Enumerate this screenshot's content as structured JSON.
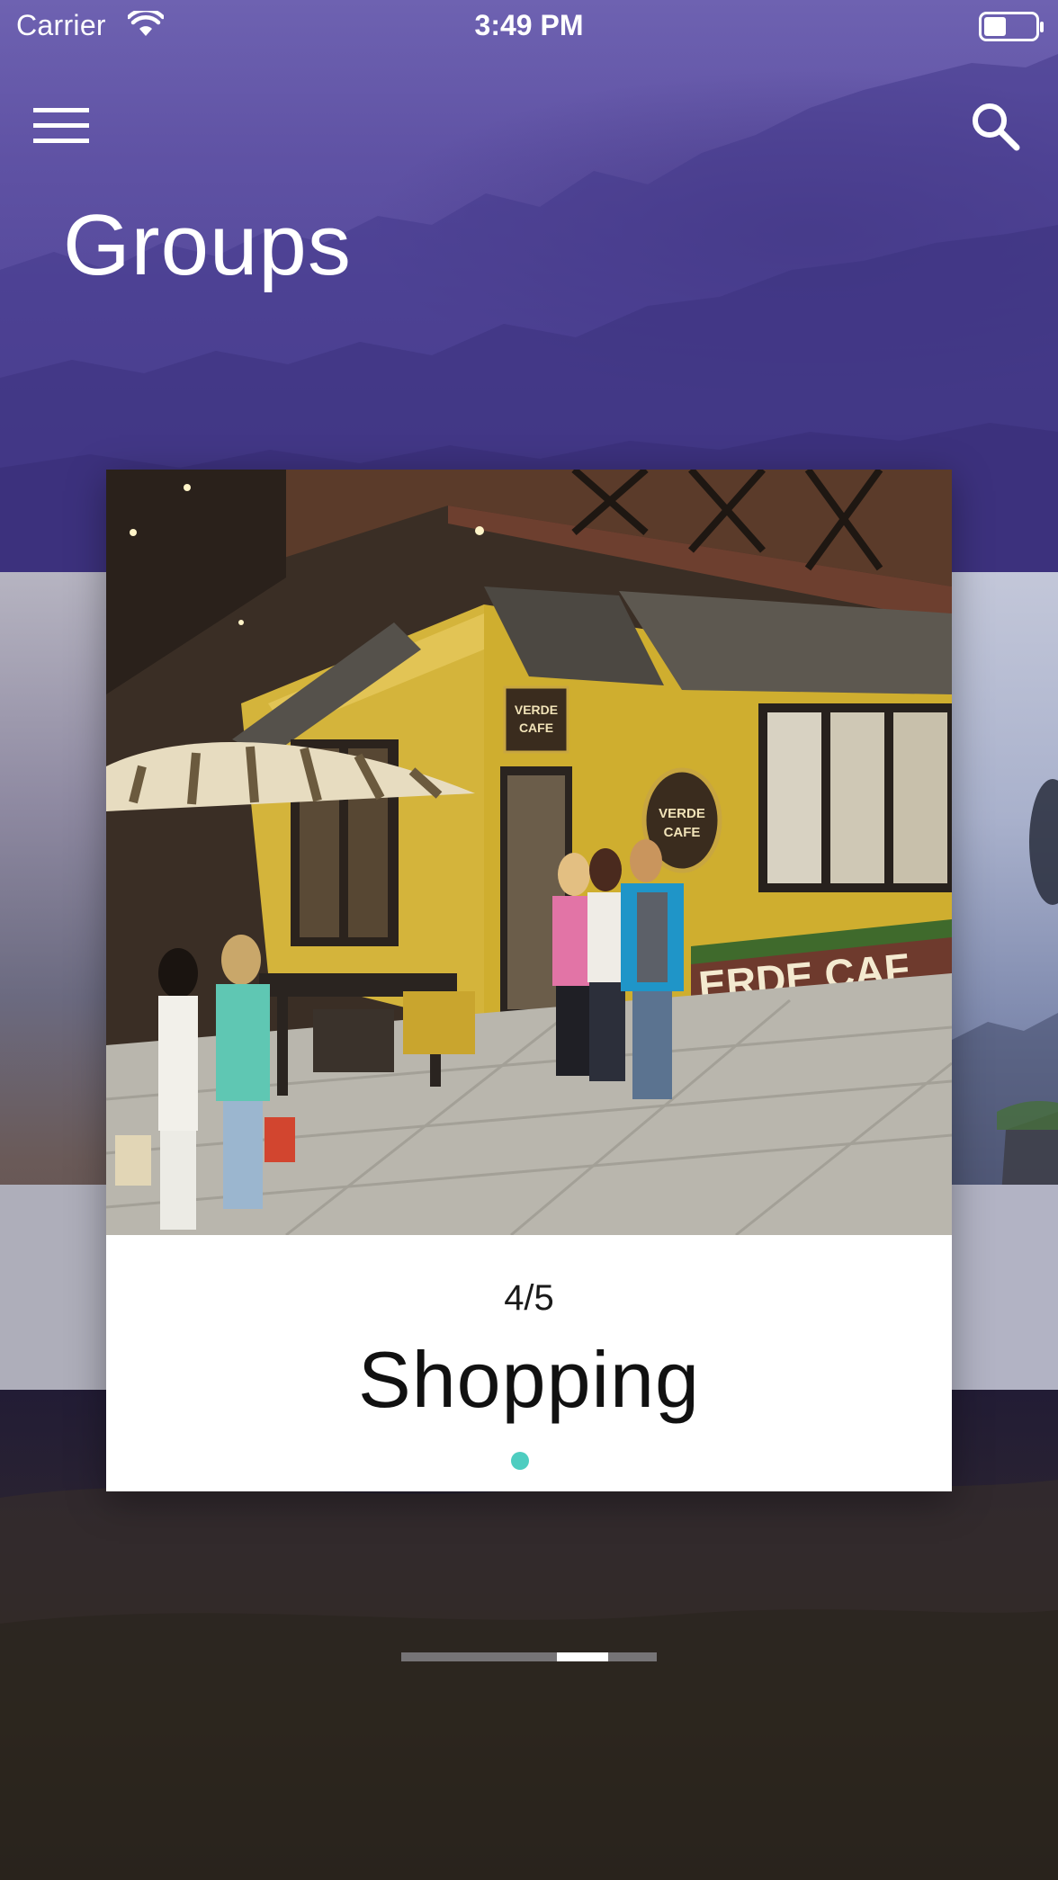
{
  "status_bar": {
    "carrier": "Carrier",
    "time": "3:49 PM"
  },
  "nav": {
    "menu_icon": "hamburger-menu-icon",
    "search_icon": "search-icon"
  },
  "page": {
    "title": "Groups"
  },
  "card": {
    "counter": "4/5",
    "title": "Shopping",
    "image": {
      "sign_text_small": "VERDE\nCAFE",
      "sign_text_round": "VERDE\nCAFE",
      "facade_text": "VERDE CAF"
    }
  },
  "carousel": {
    "current_index": 4,
    "total": 5
  },
  "colors": {
    "header_purple": "#5f52a4",
    "accent_teal": "#4ecdc0",
    "text_white": "#ffffff",
    "text_dark": "#111111"
  }
}
